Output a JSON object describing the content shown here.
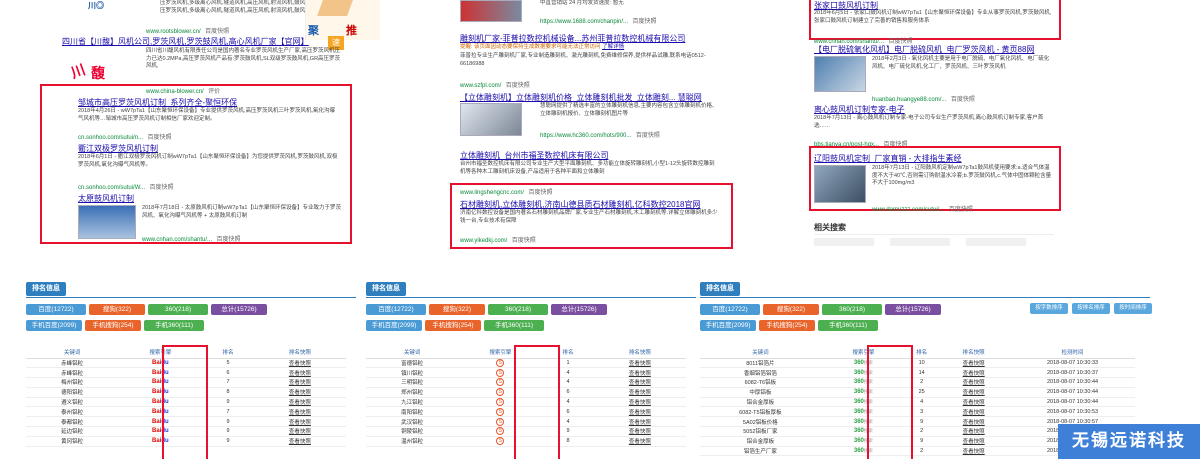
{
  "col1": {
    "top": {
      "snip_top": "压罗茨风机,多级离心风机,隧道风机,高压风机,射流风机,鼓风机,",
      "snip_top2": "压罗茨风机,多级离心风机,隧道风机,高压风机,射流风机,鼓风机,",
      "url": "www.rootsblower.cn/",
      "kuaizhao": "百度快照",
      "ad_chars": [
        "聚",
        "速",
        "推"
      ]
    },
    "r1": {
      "title": "四川省【川馥】风机公司,罗茨风机,罗茨鼓风机,高心风机厂家【官网】",
      "snip": "四川省川馥风机有限责任公司是国内著名专业罗茨风机生产厂家,高压罗茨风机压力已达0.2MPa,高压罗茨风机产品有:罗茨鼓风机,SL双级罗茨鼓风机,GR高压罗茨风机,",
      "url": "www.china-blower.cn/",
      "eval": "评价"
    },
    "r2": {
      "title": "邹城市高压罗茨风机订制_系列齐全-聚恒环保",
      "snip": "2018年4月26日 - wW7pTa1【山东聚恒环保设备】专业提供罗茨风机,高压罗茨风机三叶罗茨风机,氧化沟曝气风机等…邹城市高压罗茨风机订制相信厂家欢迎定制。",
      "url": "cn.sonhoo.com/sutui/n...",
      "kuaizhao": "百度快照"
    },
    "r3": {
      "title": "衢江双极罗茨风机订制",
      "snip": "2018年6月1日 - 衢江双极罗茨风机订制wW7pTa1【山东聚恒环保设备】为您提供罗茨风机,罗茨鼓风机,双极罗茨风机,氧化沟曝气风机等。",
      "url": "cn.sonhoo.com/sutui/W...",
      "kuaizhao": "百度快照"
    },
    "r4": {
      "title": "太原鼓风机订制",
      "snip": "2018年7月18日 - 太原鼓风机订制wW7pTa1【山东聚恒环保设备】专业致力于罗茨风机、氧化沟曝气风机等 + 太原鼓风机订制",
      "url": "www.cnhan.com/shantu/...",
      "kuaizhao": "百度快照"
    }
  },
  "col2": {
    "top": {
      "snip": "中直营销站 24 月均发货速度: 暂无",
      "url": "https://www.1688.com/chanpin/...",
      "kuaizhao": "百度快照"
    },
    "r1": {
      "title": "雕刻机厂家-菲普拉数控机械设备...苏州菲普拉数控机械有限公司",
      "tip": "提醒: 该页面因动态要保持生成数据要求可能无法正常访问",
      "tip2": "了解详情",
      "snip": "菲普拉专业生产雕刻机厂家,专业制造雕刻机、激光雕刻机,免费维修保养,提供样品试雕,联系电话0512-66186988",
      "url": "www.szfpl.com/",
      "kuaizhao": "百度快照"
    },
    "r2": {
      "title": "【立体雕刻机】立体雕刻机价格_立体雕刻机批发_立体雕刻... 慧聪网",
      "snip": "慧聪网提供了精选丰富的立体雕刻机信息,主要内容包含立体雕刻机价格、立体雕刻机报价、立体雕刻机图片等",
      "url": "https://www.hc360.com/hots/900...",
      "kuaizhao": "百度快照"
    },
    "r3": {
      "title": "立体雕刻机_台州市福圣数控机床有限公司",
      "snip": "台州市福圣数控机床有限公司专业生产大型平面雕刻机、多功能立体旋转雕刻机,小型1-12头旋转数控雕刻机等各种木工雕刻机床设备,产品适用于各种平面和立体雕刻",
      "url": "www.lingshengcnc.com/",
      "kuaizhao": "百度快照"
    },
    "r4": {
      "title": "石材雕刻机,立体雕刻机,济南山德县质石材雕刻机,亿科数控2018官网",
      "snip": "济南亿科数控设备是国内著名石材雕刻机品牌厂家,专业生产石材雕刻机,木工雕刻机等.详解立体雕刻机多少钱一台,专业技术有保障",
      "url": "www.yikedkj.com/",
      "kuaizhao": "百度快照"
    }
  },
  "col3": {
    "r1": {
      "title": "张家口鼓风机订制",
      "snip": "2018年6月5日 - 张家口鼓风机订制wW7pTa1【山东聚恒环保设备】专业从事罗茨风机,罗茨鼓风机,张家口鼓风机订制建立了完善的销售和服务体系",
      "url": "www.cnhan.com/shantu/...",
      "kuaizhao": "百度快照"
    },
    "r2": {
      "title": "【电厂脱硫氧化风机】电厂脱硫风机_电厂罗茨风机 - 黄页88网",
      "snip": "2018年2月3日 - 氧化风机主要是用于电厂脱硫、电厂氧化风机、电厂硫化风机、电厂硫化风机,化工厂、罗茨风机、三叶罗茨风机",
      "url": "huanbao.huangye88.com/...",
      "kuaizhao": "百度快照"
    },
    "r3": {
      "title": "离心鼓风机订制专家-电子",
      "snip": "2018年7月13日 - 离心鼓风机订制专家-电子公司专业生产罗茨风机,离心鼓风机订制专家,客户首选……",
      "url": "bbs.tianya.cn/post-hqx...",
      "kuaizhao": "百度快照"
    },
    "r4": {
      "title": "辽阳鼓风机定制_厂家直销 - 大排指生素经",
      "snip": "2018年7月13日 - 辽阳鼓风机定制wW7pTa1鼓风机使用要求:a.适合气体温度不大于40℃,否则需订购耐温水冷套;b.罗茨鼓风机,c.气体中固体颗粒含量不大于100mg/m3",
      "url": "www.damuzzz.com/sutui/...",
      "kuaizhao": "百度快照"
    },
    "related": "相关搜索"
  },
  "panel_title": "排名信息",
  "panels": [
    {
      "pills": [
        "百度(12722)",
        "搜狗(322)",
        "360(218)",
        "总计(15726)",
        "手机百度(2099)",
        "手机搜狗(254)",
        "手机360(111)"
      ],
      "headers": [
        "关键词",
        "搜索引擎",
        "排名",
        "排名快照"
      ],
      "engine": "baidu",
      "rows": [
        [
          "赤峰铝粒",
          "5",
          "查看快照"
        ],
        [
          "赤峰铝粒",
          "6",
          "查看快照"
        ],
        [
          "梅州铝粒",
          "7",
          "查看快照"
        ],
        [
          "德阳铝粒",
          "8",
          "查看快照"
        ],
        [
          "遵义铝粒",
          "9",
          "查看快照"
        ],
        [
          "泰州铝粒",
          "7",
          "查看快照"
        ],
        [
          "泰都铝粒",
          "9",
          "查看快照"
        ],
        [
          "延边铝粒",
          "9",
          "查看快照"
        ],
        [
          "黄冈铝粒",
          "9",
          "查看快照"
        ]
      ]
    },
    {
      "pills": [
        "百度(12722)",
        "搜狗(322)",
        "360(218)",
        "总计(15726)",
        "手机百度(2099)",
        "手机搜狗(254)",
        "手机360(111)"
      ],
      "headers": [
        "关键词",
        "搜索引擎",
        "排名",
        "排名快照"
      ],
      "engine": "sogou",
      "rows": [
        [
          "富德铝粒",
          "1",
          "查看快照"
        ],
        [
          "镇川铝粒",
          "4",
          "查看快照"
        ],
        [
          "三明铝粒",
          "4",
          "查看快照"
        ],
        [
          "郑州铝粒",
          "6",
          "查看快照"
        ],
        [
          "九江铝粒",
          "4",
          "查看快照"
        ],
        [
          "南阳铝粒",
          "6",
          "查看快照"
        ],
        [
          "武汉铝粒",
          "4",
          "查看快照"
        ],
        [
          "铜陵铝粒",
          "9",
          "查看快照"
        ],
        [
          "温州铝粒",
          "8",
          "查看快照"
        ]
      ]
    },
    {
      "pills": [
        "百度(12722)",
        "搜狗(322)",
        "360(218)",
        "总计(15726)",
        "手机百度(2099)",
        "手机搜狗(254)",
        "手机360(111)"
      ],
      "tools": [
        "按字数排序",
        "按排名排序",
        "按时间排序"
      ],
      "headers": [
        "关键词",
        "搜索引擎",
        "排名",
        "排名快照",
        "检测时间"
      ],
      "engine": "360",
      "rows": [
        [
          "8011铝箔片",
          "10",
          "查看快照",
          "2018-08-07 10:30:33"
        ],
        [
          "香烟铝箔铝箔",
          "14",
          "查看快照",
          "2018-08-07 10:30:37"
        ],
        [
          "6082-T6铝板",
          "2",
          "查看快照",
          "2018-08-07 10:30:44"
        ],
        [
          "中厚铝板",
          "25",
          "查看快照",
          "2018-08-07 10:30:44"
        ],
        [
          "铝合金厚板",
          "4",
          "查看快照",
          "2018-08-07 10:30:44"
        ],
        [
          "6082-T5铝板厚板",
          "3",
          "查看快照",
          "2018-08-07 10:30:53"
        ],
        [
          "5A02铝板价格",
          "9",
          "查看快照",
          "2018-08-07 10:30:57"
        ],
        [
          "5052铝板厂家",
          "2",
          "查看快照",
          "2018-08-07 10:31:00"
        ],
        [
          "铝合金厚板",
          "9",
          "查看快照",
          "2018-08-07 10:31:00"
        ],
        [
          "铝箔生产厂家",
          "2",
          "查看快照",
          "2018-08-07 10:31:05"
        ]
      ]
    }
  ],
  "engine_labels": {
    "baidu_a": "Bai",
    "baidu_b": "du",
    "sogou": "S",
    "s360a": "360",
    "s360b": "搜索"
  },
  "watermark": "无锡远诺科技"
}
